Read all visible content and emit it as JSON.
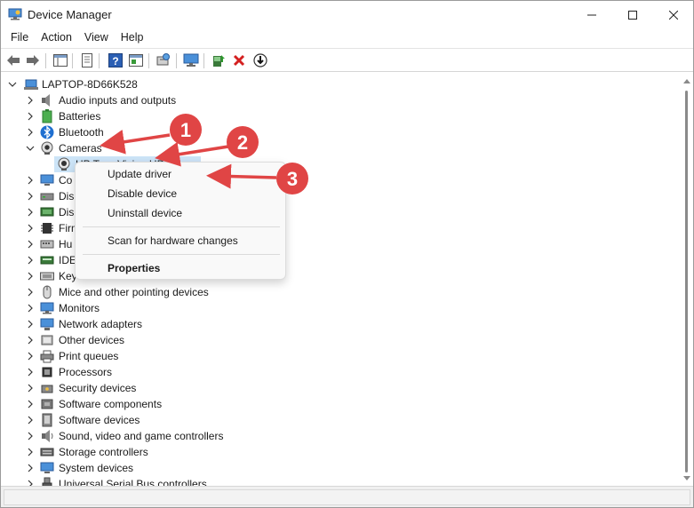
{
  "window": {
    "title": "Device Manager",
    "controls": {
      "minimize": "minimize",
      "maximize": "maximize",
      "close": "close"
    }
  },
  "menu": [
    "File",
    "Action",
    "View",
    "Help"
  ],
  "toolbar": {
    "icons": [
      "back-arrow-icon",
      "forward-arrow-icon",
      "show-hide-tree-icon",
      "properties-icon",
      "help-icon",
      "action-pane-icon",
      "scan-hardware-icon",
      "monitor-icon",
      "update-driver-icon",
      "uninstall-icon",
      "disable-device-icon"
    ]
  },
  "tree": {
    "root": "LAPTOP-8D66K528",
    "camera_child": "HP True Vision HD Camera",
    "items": [
      {
        "label": "Audio inputs and outputs",
        "icon": "speaker-icon",
        "expanded": false
      },
      {
        "label": "Batteries",
        "icon": "battery-icon",
        "expanded": false
      },
      {
        "label": "Bluetooth",
        "icon": "bluetooth-icon",
        "expanded": false
      },
      {
        "label": "Cameras",
        "icon": "camera-icon",
        "expanded": true
      },
      {
        "label": "Co",
        "icon": "computer-icon",
        "expanded": false
      },
      {
        "label": "Dis",
        "icon": "disk-drive-icon",
        "expanded": false
      },
      {
        "label": "Dis",
        "icon": "display-adapter-icon",
        "expanded": false
      },
      {
        "label": "Firm",
        "icon": "firmware-icon",
        "expanded": false
      },
      {
        "label": "Hu",
        "icon": "hid-icon",
        "expanded": false
      },
      {
        "label": "IDE",
        "icon": "ide-icon",
        "expanded": false
      },
      {
        "label": "Key",
        "icon": "keyboard-icon",
        "expanded": false
      },
      {
        "label": "Mice and other pointing devices",
        "icon": "mouse-icon",
        "expanded": false
      },
      {
        "label": "Monitors",
        "icon": "monitor-icon",
        "expanded": false
      },
      {
        "label": "Network adapters",
        "icon": "network-icon",
        "expanded": false
      },
      {
        "label": "Other devices",
        "icon": "other-device-icon",
        "expanded": false
      },
      {
        "label": "Print queues",
        "icon": "printer-icon",
        "expanded": false
      },
      {
        "label": "Processors",
        "icon": "processor-icon",
        "expanded": false
      },
      {
        "label": "Security devices",
        "icon": "security-icon",
        "expanded": false
      },
      {
        "label": "Software components",
        "icon": "software-component-icon",
        "expanded": false
      },
      {
        "label": "Software devices",
        "icon": "software-device-icon",
        "expanded": false
      },
      {
        "label": "Sound, video and game controllers",
        "icon": "sound-icon",
        "expanded": false
      },
      {
        "label": "Storage controllers",
        "icon": "storage-icon",
        "expanded": false
      },
      {
        "label": "System devices",
        "icon": "system-device-icon",
        "expanded": false
      },
      {
        "label": "Universal Serial Bus controllers",
        "icon": "usb-icon",
        "expanded": false
      }
    ]
  },
  "context_menu": {
    "update_driver": "Update driver",
    "disable_device": "Disable device",
    "uninstall_device": "Uninstall device",
    "scan": "Scan for hardware changes",
    "properties": "Properties"
  },
  "annotations": {
    "badge_1": "1",
    "badge_2": "2",
    "badge_3": "3",
    "color": "#e04545"
  }
}
